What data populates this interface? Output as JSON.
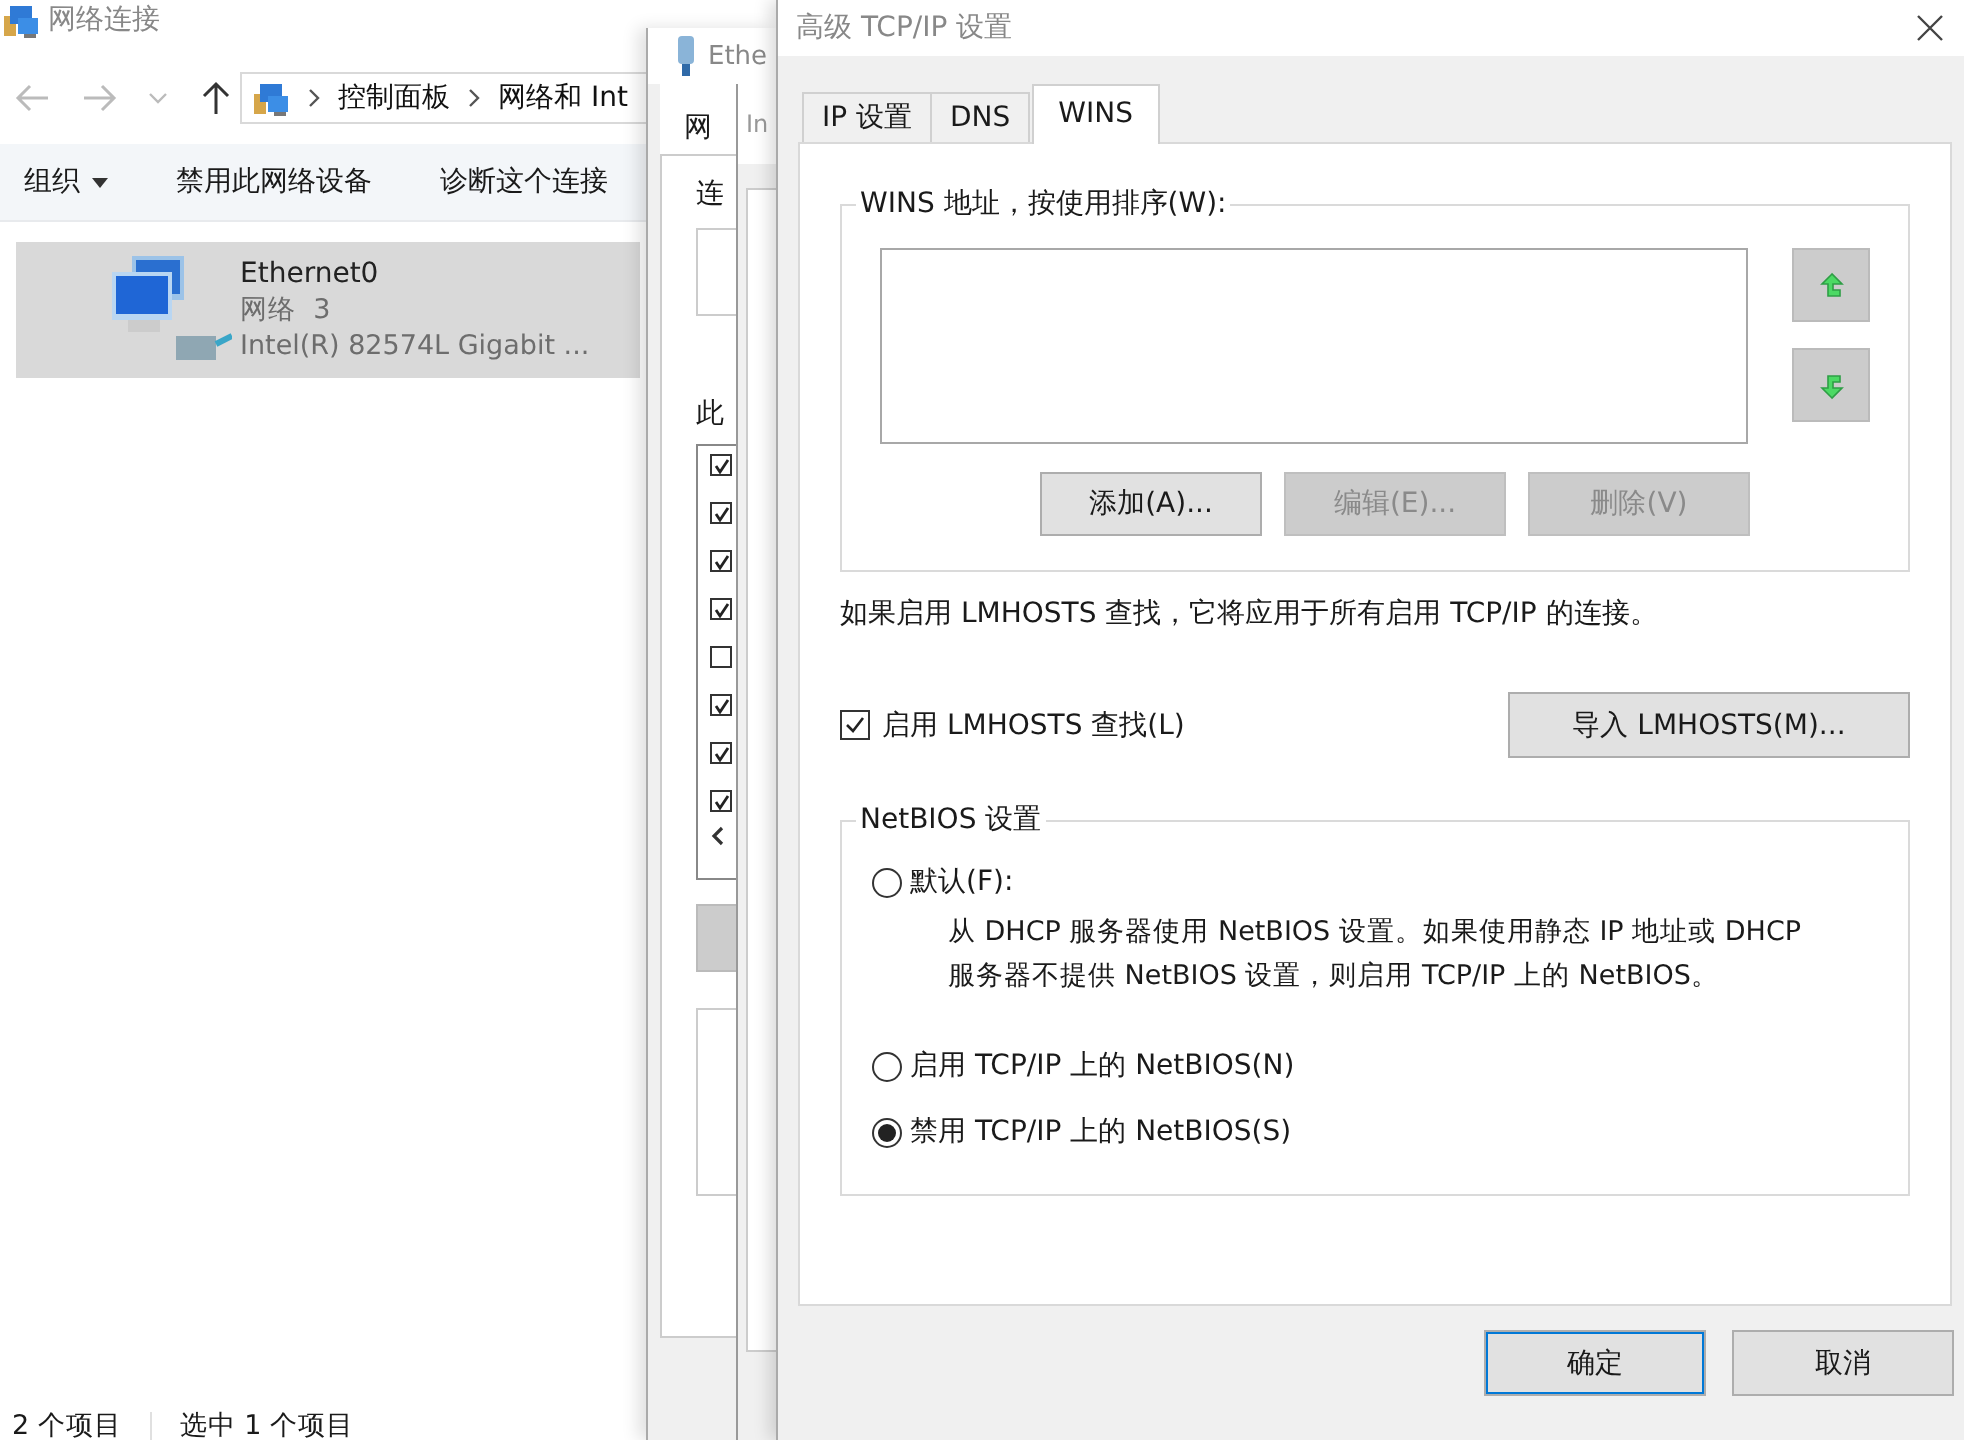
{
  "explorer": {
    "title": "网络连接",
    "breadcrumb": [
      "控制面板",
      "网络和 Int"
    ],
    "toolbar": [
      {
        "label": "组织",
        "dropdown": true
      },
      {
        "label": "禁用此网络设备",
        "dropdown": false
      },
      {
        "label": "诊断这个连接",
        "dropdown": false
      }
    ],
    "items": [
      {
        "name": "Ethernet0",
        "network": "网络  3",
        "adapter": "Intel(R) 82574L Gigabit ...",
        "selected": true
      }
    ],
    "status_bar": [
      "2 个项目",
      "选中 1 个项目"
    ]
  },
  "ethernet_window": {
    "title": "Ethe",
    "tab": "网",
    "labels": [
      "连",
      "此"
    ],
    "components": [
      {
        "checked": true
      },
      {
        "checked": true
      },
      {
        "checked": true
      },
      {
        "checked": true
      },
      {
        "checked": false
      },
      {
        "checked": true
      },
      {
        "checked": true
      },
      {
        "checked": true
      }
    ]
  },
  "ipv4_window": {
    "title": "In"
  },
  "advanced_window": {
    "title": "高级 TCP/IP 设置",
    "tabs": [
      {
        "label": "IP 设置",
        "selected": false
      },
      {
        "label": "DNS",
        "selected": false
      },
      {
        "label": "WINS",
        "selected": true
      }
    ],
    "wins_group": {
      "legend": "WINS 地址，按使用排序(W):",
      "buttons": [
        {
          "label": "添加(A)...",
          "disabled": false
        },
        {
          "label": "编辑(E)...",
          "disabled": true
        },
        {
          "label": "删除(V)",
          "disabled": true
        }
      ]
    },
    "lmhosts_note": "如果启用 LMHOSTS 查找，它将应用于所有启用 TCP/IP 的连接。",
    "lmhosts_checkbox": {
      "label": "启用 LMHOSTS 查找(L)",
      "checked": true
    },
    "import_button": "导入 LMHOSTS(M)...",
    "netbios_group": {
      "legend": "NetBIOS 设置",
      "options": [
        {
          "label": "默认(F):",
          "selected": false,
          "description": "从 DHCP 服务器使用 NetBIOS 设置。如果使用静态 IP 地址或 DHCP\n服务器不提供 NetBIOS 设置，则启用 TCP/IP 上的 NetBIOS。"
        },
        {
          "label": "启用 TCP/IP 上的 NetBIOS(N)",
          "selected": false
        },
        {
          "label": "禁用 TCP/IP 上的 NetBIOS(S)",
          "selected": true
        }
      ]
    },
    "buttons": [
      {
        "label": "确定",
        "default": true
      },
      {
        "label": "取消",
        "default": false
      }
    ]
  }
}
